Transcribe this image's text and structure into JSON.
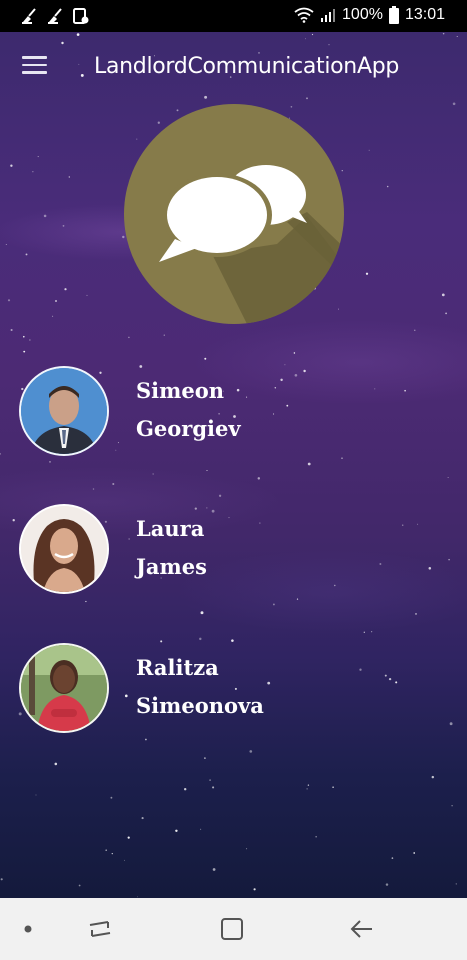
{
  "status_bar": {
    "battery": "100%",
    "time": "13:01",
    "left_icons": [
      "broom-icon",
      "broom-icon",
      "gallery-icon"
    ],
    "right_icons": [
      "wifi-icon",
      "signal-icon",
      "battery-icon"
    ]
  },
  "app": {
    "title": "LandlordCommunicationApp",
    "logo_icon": "chat-bubbles-icon",
    "logo_color": "#867b4a",
    "menu_icon": "hamburger-menu-icon"
  },
  "contacts": [
    {
      "first": "Simeon",
      "last": "Georgiev",
      "avatar_bg": "#4f8fd0"
    },
    {
      "first": "Laura",
      "last": "James",
      "avatar_bg": "#f2ece8"
    },
    {
      "first": "Ralitza",
      "last": "Simeonova",
      "avatar_bg": "#7e9a62"
    }
  ],
  "nav_bar": {
    "icons": [
      "dot-icon",
      "recent-apps-icon",
      "home-icon",
      "back-icon"
    ]
  }
}
